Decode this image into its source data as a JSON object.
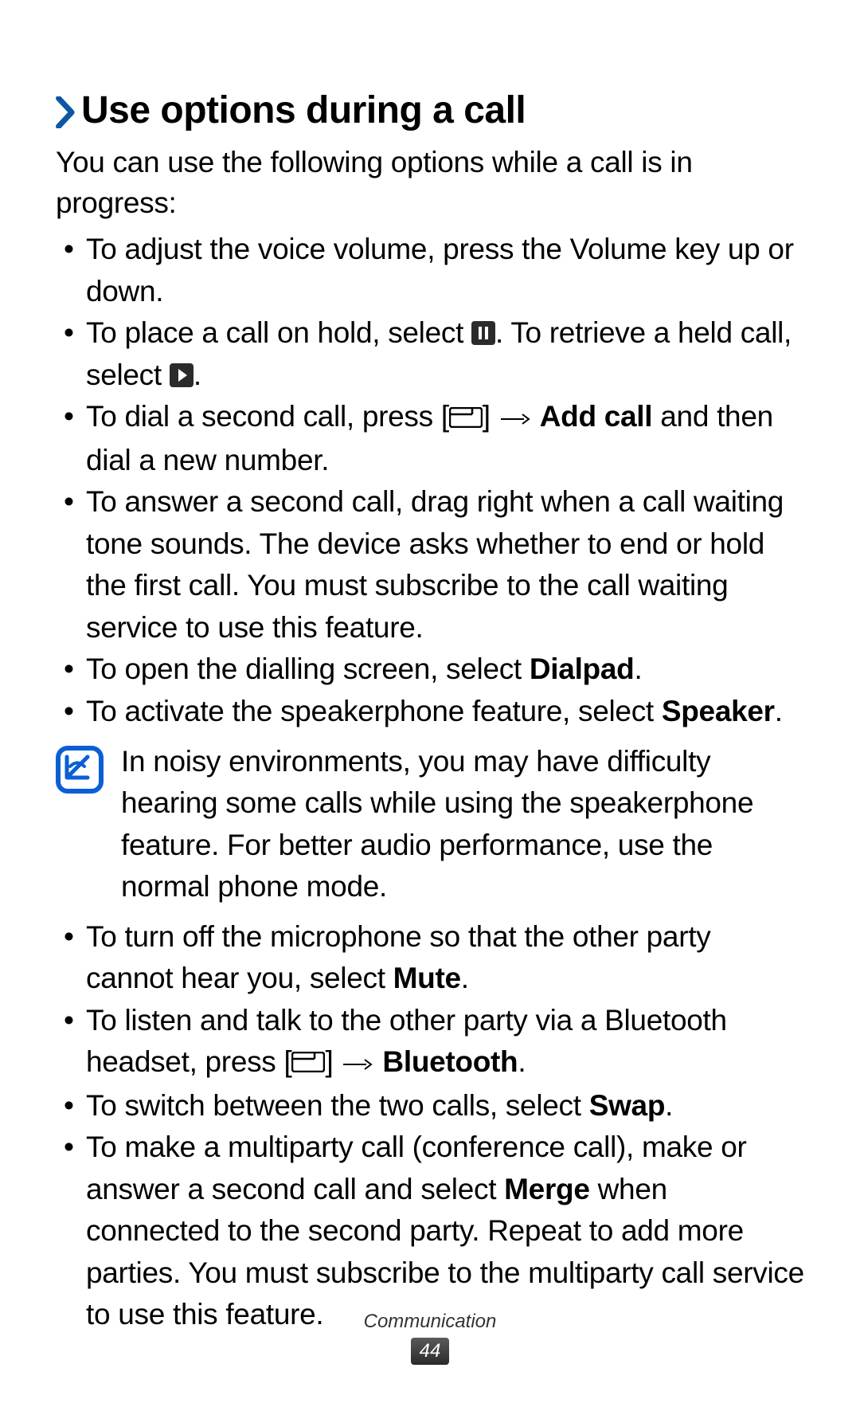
{
  "heading": {
    "chevron": "›",
    "title": "Use options during a call"
  },
  "intro": "You can use the following options while a call is in progress:",
  "bullets1": {
    "b0": "To adjust the voice volume, press the Volume key up or down.",
    "b1_a": "To place a call on hold, select ",
    "b1_b": ". To retrieve a held call, select ",
    "b1_c": ".",
    "b2_a": "To dial a second call, press [",
    "b2_arrow": "→",
    "b2_bold": "Add call",
    "b2_b": " and then dial a new number.",
    "b3": "To answer a second call, drag       right when a call waiting tone sounds. The device asks whether to end or hold the first call. You must subscribe to the call waiting service to use this feature.",
    "b4_a": "To open the dialling screen, select ",
    "b4_bold": "Dialpad",
    "b4_b": ".",
    "b5_a": "To activate the speakerphone feature, select ",
    "b5_bold": "Speaker",
    "b5_b": "."
  },
  "note": "In noisy environments, you may have difficulty hearing some calls while using the speakerphone feature. For better audio performance, use the normal phone mode.",
  "bullets2": {
    "b0_a": "To turn off the microphone so that the other party cannot hear you, select ",
    "b0_bold": "Mute",
    "b0_b": ".",
    "b1_a": "To listen and talk to the other party via a Bluetooth headset, press [",
    "b1_arrow": "→",
    "b1_bold": "Bluetooth",
    "b1_b": ".",
    "b2_a": "To switch between the two calls, select ",
    "b2_bold": "Swap",
    "b2_b": ".",
    "b3_a": "To make a multiparty call (conference call), make or answer a second call and select ",
    "b3_bold": "Merge",
    "b3_b": " when connected to the second party. Repeat to add more parties. You must subscribe to the multiparty call service to use this feature."
  },
  "footer": {
    "section": "Communication",
    "page": "44"
  },
  "icons": {
    "menu_bracket_close": "] "
  }
}
